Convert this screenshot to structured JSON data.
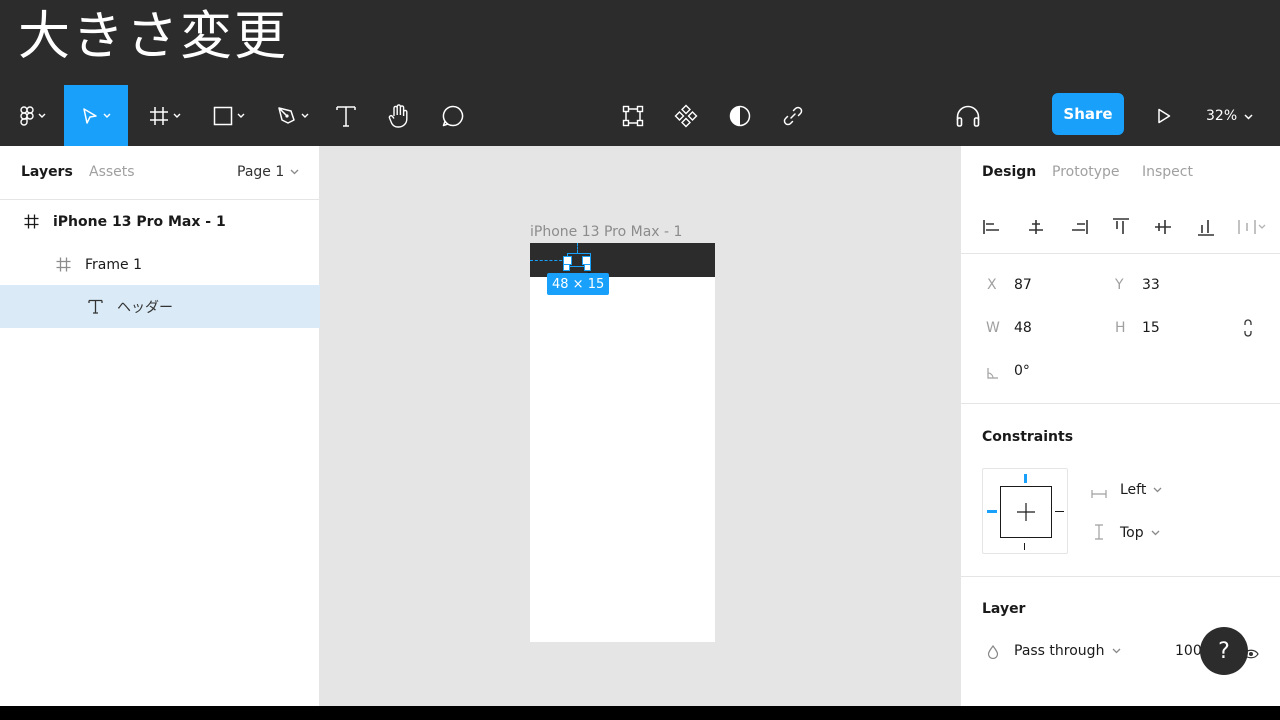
{
  "caption": "大きさ変更",
  "toolbar": {
    "share_label": "Share",
    "zoom_label": "32%",
    "left_tools": [
      "figma-menu-icon",
      "move-icon",
      "frame-icon",
      "rectangle-icon",
      "pen-icon",
      "text-icon",
      "hand-icon",
      "comment-icon"
    ],
    "center_tools": [
      "resize-icon",
      "component-icon",
      "mask-icon",
      "link-icon"
    ],
    "accent_color": "#18a0fb"
  },
  "left_panel": {
    "tabs": [
      "Layers",
      "Assets"
    ],
    "page_label": "Page 1",
    "layers": [
      {
        "name": "iPhone 13 Pro Max - 1",
        "icon": "frame-icon"
      },
      {
        "name": "Frame 1",
        "icon": "frame-icon"
      },
      {
        "name": "ヘッダー",
        "icon": "text-icon",
        "selected": true
      }
    ]
  },
  "canvas": {
    "frame_label": "iPhone 13 Pro Max - 1",
    "dimension_badge": "48 × 15"
  },
  "right_panel": {
    "tabs": [
      "Design",
      "Prototype",
      "Inspect"
    ],
    "x_label": "X",
    "x_value": "87",
    "y_label": "Y",
    "y_value": "33",
    "w_label": "W",
    "w_value": "48",
    "h_label": "H",
    "h_value": "15",
    "rotation_value": "0°",
    "constraints_title": "Constraints",
    "constraint_h": "Left",
    "constraint_v": "Top",
    "layer_title": "Layer",
    "blend_mode": "Pass through",
    "opacity": "100"
  },
  "help_label": "?"
}
